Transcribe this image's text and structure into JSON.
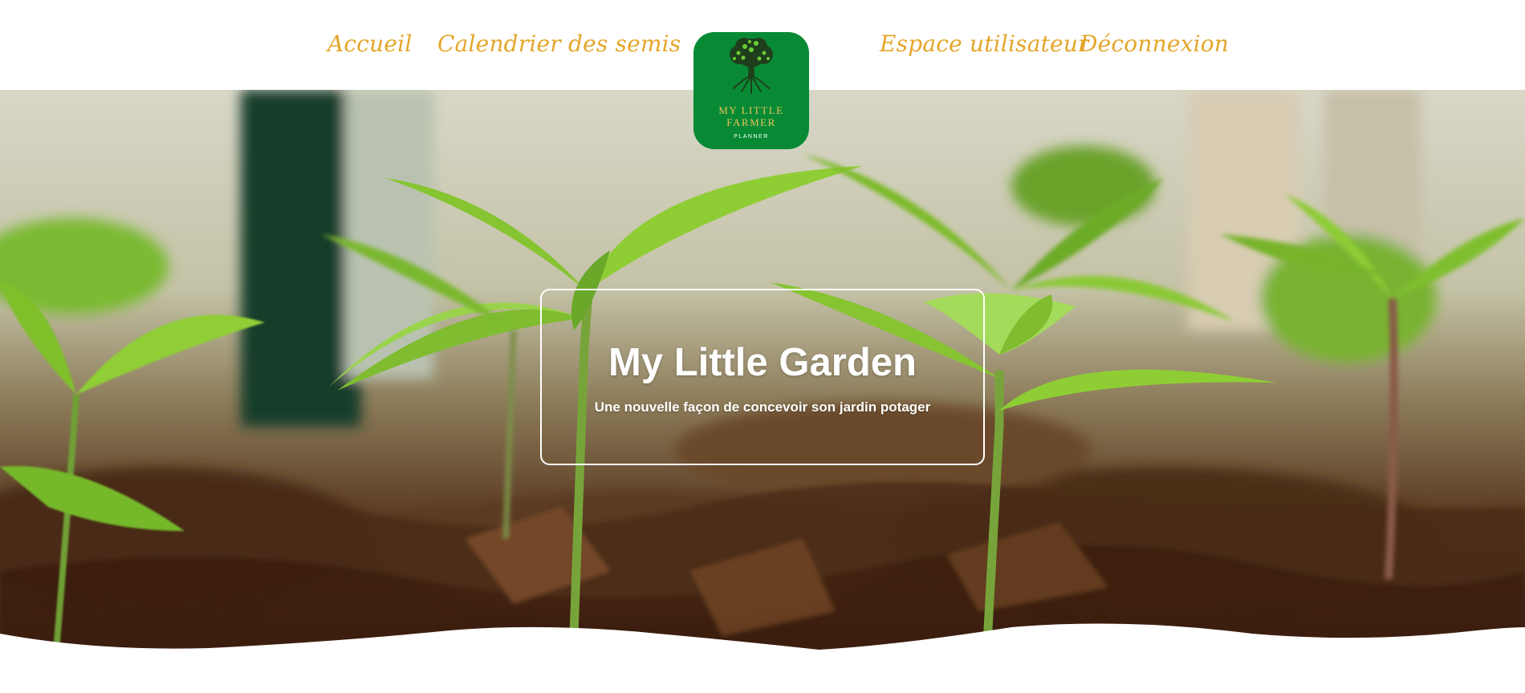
{
  "nav": {
    "home_label": "Accueil",
    "calendar_label": "Calendrier des semis",
    "user_label": "Espace utilisateur",
    "logout_label": "Déconnexion"
  },
  "logo": {
    "line1": "MY LITTLE",
    "line2": "FARMER",
    "line3": "PLANNER",
    "icon": "tree-icon",
    "background": "#088a35",
    "text_color": "#e9c45b"
  },
  "hero": {
    "title": "My Little Garden",
    "subtitle": "Une nouvelle façon de concevoir son jardin potager"
  },
  "colors": {
    "accent": "#e4a62a",
    "brand_green": "#088a35"
  }
}
